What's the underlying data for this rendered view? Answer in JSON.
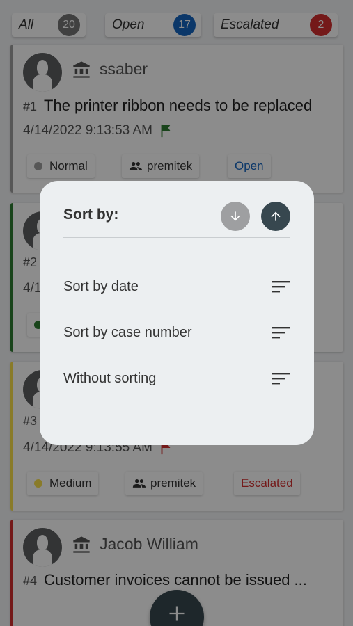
{
  "filters": [
    {
      "label": "All",
      "count": "20",
      "color": "#757575"
    },
    {
      "label": "Open",
      "count": "17",
      "color": "#1565c0"
    },
    {
      "label": "Escalated",
      "count": "2",
      "color": "#d32f2f"
    }
  ],
  "cards": [
    {
      "stripe_color": "#9e9e9e",
      "customer": "ssaber",
      "case_number": "#1",
      "title": "The printer ribbon needs to be replaced",
      "date": "4/14/2022 9:13:53 AM",
      "flag_color": "#2e7d32",
      "priority": "Normal",
      "priority_color": "#9e9e9e",
      "assignee": "premitek",
      "status": "Open"
    },
    {
      "stripe_color": "#2e7d32",
      "case_number": "#2",
      "date_fragment": "4/1",
      "priority_color": "#2e7d32"
    },
    {
      "stripe_color": "#f9e04b",
      "case_number": "#3",
      "date": "4/14/2022 9:13:55 AM",
      "flag_color": "#d32f2f",
      "priority": "Medium",
      "priority_color": "#f9e04b",
      "assignee": "premitek",
      "status": "Escalated"
    },
    {
      "stripe_color": "#d32f2f",
      "customer": "Jacob William",
      "case_number": "#4",
      "title": "Customer invoices cannot be issued ..."
    }
  ],
  "sort_dialog": {
    "title": "Sort by:",
    "direction_down_icon": "arrow-down-icon",
    "direction_up_icon": "arrow-up-icon",
    "options": [
      {
        "label": "Sort by date",
        "icon": "sort-lines-icon"
      },
      {
        "label": "Sort by case number",
        "icon": "sort-lines-icon"
      },
      {
        "label": "Without sorting",
        "icon": "sort-lines-icon"
      }
    ]
  },
  "fab": {
    "icon": "plus-icon"
  }
}
